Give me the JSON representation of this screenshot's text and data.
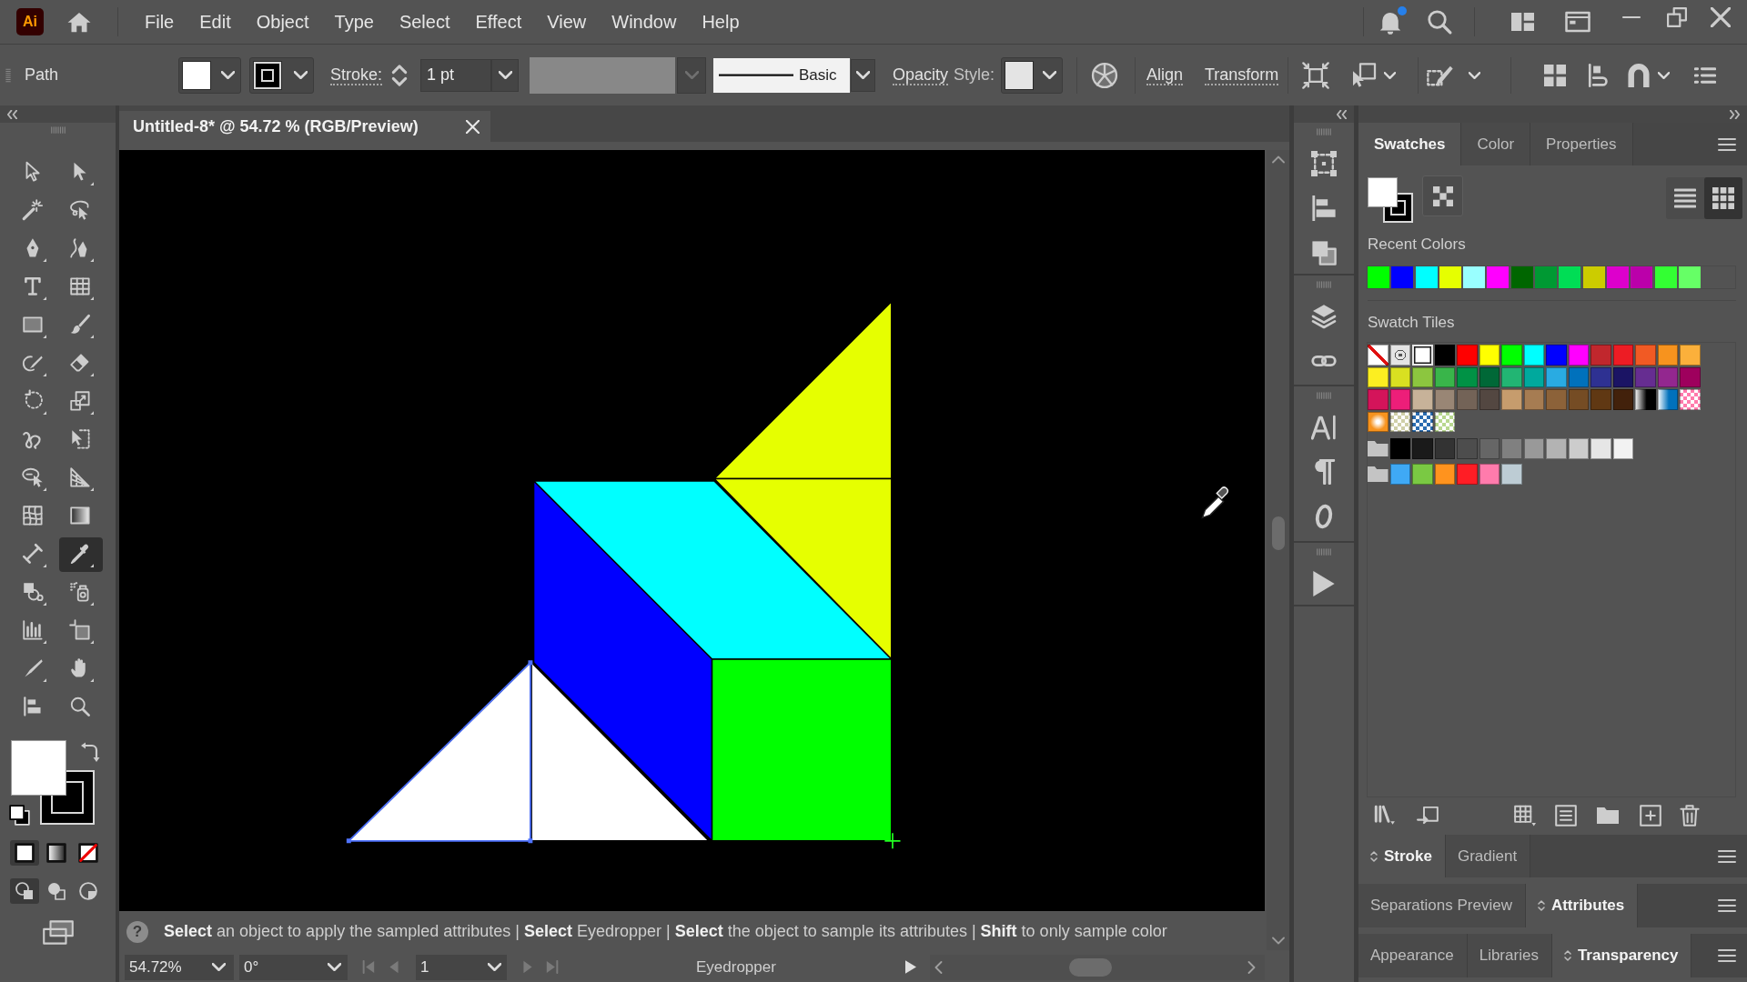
{
  "app": {
    "logo": "Ai"
  },
  "menu": [
    "File",
    "Edit",
    "Object",
    "Type",
    "Select",
    "Effect",
    "View",
    "Window",
    "Help"
  ],
  "notifications": {
    "unread": true
  },
  "control_bar": {
    "selection": "Path",
    "fill_stroke": [
      {
        "kind": "fill",
        "color": "#ffffff"
      },
      {
        "kind": "stroke",
        "color": "#000000"
      }
    ],
    "stroke_label": "Stroke:",
    "stroke_weight": "1 pt",
    "variable_width": {
      "disabled": true
    },
    "brush": "Basic",
    "opacity": "Opacity",
    "style_label": "Style:",
    "links": [
      "Align",
      "Transform"
    ]
  },
  "tools": [
    {
      "kind": "selection",
      "selected": false
    },
    {
      "kind": "direct",
      "selected": false
    },
    {
      "kind": "wand",
      "selected": false
    },
    {
      "kind": "lasso",
      "selected": false
    },
    {
      "kind": "pen",
      "selected": false
    },
    {
      "kind": "curvature",
      "selected": false
    },
    {
      "kind": "type",
      "selected": false
    },
    {
      "kind": "grid",
      "selected": false
    },
    {
      "kind": "rectangle",
      "selected": false
    },
    {
      "kind": "brush",
      "selected": false
    },
    {
      "kind": "shaper",
      "selected": false
    },
    {
      "kind": "eraser",
      "selected": false
    },
    {
      "kind": "rotate",
      "selected": false
    },
    {
      "kind": "scale",
      "selected": false
    },
    {
      "kind": "warp",
      "selected": false
    },
    {
      "kind": "transform",
      "selected": false
    },
    {
      "kind": "builder",
      "selected": false
    },
    {
      "kind": "perspective",
      "selected": false
    },
    {
      "kind": "mesh",
      "selected": false
    },
    {
      "kind": "gradient",
      "selected": false
    },
    {
      "kind": "measure",
      "selected": false
    },
    {
      "kind": "eyedropper",
      "selected": true
    },
    {
      "kind": "shapes",
      "selected": false
    },
    {
      "kind": "sprayer",
      "selected": false
    },
    {
      "kind": "graph",
      "selected": false
    },
    {
      "kind": "artboard",
      "selected": false
    },
    {
      "kind": "knife",
      "selected": false
    },
    {
      "kind": "hand",
      "selected": false
    },
    {
      "kind": "align",
      "selected": false
    },
    {
      "kind": "zoom",
      "selected": false
    }
  ],
  "toolbar": {
    "fill_stroke": [
      {
        "kind": "fill",
        "color": "#ffffff"
      },
      {
        "kind": "stroke",
        "color": "#000000"
      }
    ],
    "color_modes": [
      {
        "kind": "color",
        "selected": true
      },
      {
        "kind": "gradient",
        "selected": false
      },
      {
        "kind": "none",
        "selected": false
      }
    ],
    "draw_modes": [
      {
        "kind": "normal",
        "selected": true
      },
      {
        "kind": "behind",
        "selected": false
      },
      {
        "kind": "inside",
        "selected": false
      }
    ]
  },
  "document_tabs": [
    {
      "title": "Untitled-8* @ 54.72 % (RGB/Preview)",
      "selected": true
    }
  ],
  "hint": {
    "icon": "?",
    "text": "**Select** an object to apply the sampled attributes | **Select** Eyedropper | **Select** the object to sample its attributes | **Shift** to only sample color"
  },
  "status_bar": {
    "zoom": "54.72%",
    "rotation": "0°",
    "artboard": "1",
    "tool": "Eyedropper"
  },
  "swatches_panel": {
    "tabs": [
      {
        "label": "Swatches",
        "selected": true
      },
      {
        "label": "Color",
        "selected": false
      },
      {
        "label": "Properties",
        "selected": false
      }
    ],
    "fill_stroke": [
      {
        "kind": "fill",
        "color": "#ffffff"
      },
      {
        "kind": "stroke",
        "color": "#000000"
      }
    ],
    "views": [
      {
        "kind": "list",
        "selected": false
      },
      {
        "kind": "grid",
        "selected": true
      }
    ],
    "recent_label": "Recent Colors",
    "recent": [
      {
        "color": "#00ff00"
      },
      {
        "color": "#0000ff"
      },
      {
        "color": "#00ffff"
      },
      {
        "color": "#e6ff00"
      },
      {
        "color": "#99ffff"
      },
      {
        "color": "#ff00ff"
      },
      {
        "color": "#006600"
      },
      {
        "color": "#009933"
      },
      {
        "color": "#00dd55"
      },
      {
        "color": "#cccc00"
      },
      {
        "color": "#dd00cc"
      },
      {
        "color": "#bb00aa"
      },
      {
        "color": "#33ff33"
      },
      {
        "color": "#66ff66"
      }
    ],
    "tiles_label": "Swatch Tiles",
    "tiles": [
      {
        "kind": "none",
        "selected": false
      },
      {
        "kind": "registration",
        "selected": false
      },
      {
        "kind": "color",
        "color": "#ffffff",
        "selected": true
      },
      {
        "kind": "color",
        "color": "#000000",
        "selected": false
      },
      {
        "kind": "color",
        "color": "#ff0000",
        "selected": false
      },
      {
        "kind": "color",
        "color": "#ffff00",
        "selected": false
      },
      {
        "kind": "color",
        "color": "#00ff00",
        "selected": false
      },
      {
        "kind": "color",
        "color": "#00ffff",
        "selected": false
      },
      {
        "kind": "color",
        "color": "#0000ff",
        "selected": false
      },
      {
        "kind": "color",
        "color": "#ff00ff",
        "selected": false
      },
      {
        "kind": "color",
        "color": "#c1272d",
        "selected": false
      },
      {
        "kind": "color",
        "color": "#ed1c24",
        "selected": false
      },
      {
        "kind": "color",
        "color": "#f15a24",
        "selected": false
      },
      {
        "kind": "color",
        "color": "#f7931e",
        "selected": false
      },
      {
        "kind": "color",
        "color": "#fbb03b",
        "selected": false
      },
      {
        "kind": "color",
        "color": "#fcee21",
        "selected": false
      },
      {
        "kind": "color",
        "color": "#d9e021",
        "selected": false
      },
      {
        "kind": "color",
        "color": "#8cc63f",
        "selected": false
      },
      {
        "kind": "color",
        "color": "#39b54a",
        "selected": false
      },
      {
        "kind": "color",
        "color": "#009245",
        "selected": false
      },
      {
        "kind": "color",
        "color": "#006837",
        "selected": false
      },
      {
        "kind": "color",
        "color": "#22b573",
        "selected": false
      },
      {
        "kind": "color",
        "color": "#00a99d",
        "selected": false
      },
      {
        "kind": "color",
        "color": "#29abe2",
        "selected": false
      },
      {
        "kind": "color",
        "color": "#0071bc",
        "selected": false
      },
      {
        "kind": "color",
        "color": "#2e3192",
        "selected": false
      },
      {
        "kind": "color",
        "color": "#1b1464",
        "selected": false
      },
      {
        "kind": "color",
        "color": "#662d91",
        "selected": false
      },
      {
        "kind": "color",
        "color": "#93278f",
        "selected": false
      },
      {
        "kind": "color",
        "color": "#9e005d",
        "selected": false
      },
      {
        "kind": "color",
        "color": "#d4145a",
        "selected": false
      },
      {
        "kind": "color",
        "color": "#ed1e79",
        "selected": false
      },
      {
        "kind": "color",
        "color": "#c7b299",
        "selected": false
      },
      {
        "kind": "color",
        "color": "#998675",
        "selected": false
      },
      {
        "kind": "color",
        "color": "#736357",
        "selected": false
      },
      {
        "kind": "color",
        "color": "#534741",
        "selected": false
      },
      {
        "kind": "color",
        "color": "#c69c6d",
        "selected": false
      },
      {
        "kind": "color",
        "color": "#a67c52",
        "selected": false
      },
      {
        "kind": "color",
        "color": "#8c6239",
        "selected": false
      },
      {
        "kind": "color",
        "color": "#754c24",
        "selected": false
      },
      {
        "kind": "color",
        "color": "#603813",
        "selected": false
      },
      {
        "kind": "color",
        "color": "#42210b",
        "selected": false
      },
      {
        "kind": "gradient",
        "color": "#000000",
        "selected": false
      },
      {
        "kind": "gradient",
        "color": "#0071bc",
        "selected": false
      },
      {
        "kind": "pattern",
        "color": "#ff7bac",
        "selected": false
      },
      {
        "kind": "radial",
        "color": "#f7931e",
        "selected": false
      },
      {
        "kind": "pattern",
        "color": "#cfcfa8",
        "selected": false
      },
      {
        "kind": "pattern",
        "color": "#2b6cb0",
        "selected": false
      },
      {
        "kind": "pattern",
        "color": "#b8d890",
        "selected": false
      }
    ],
    "groups": [
      {
        "swatches": [
          {
            "color": "#000000"
          },
          {
            "color": "#1a1a1a"
          },
          {
            "color": "#333333"
          },
          {
            "color": "#4d4d4d"
          },
          {
            "color": "#666666"
          },
          {
            "color": "#808080"
          },
          {
            "color": "#999999"
          },
          {
            "color": "#b3b3b3"
          },
          {
            "color": "#cccccc"
          },
          {
            "color": "#e6e6e6"
          },
          {
            "color": "#f2f2f2"
          }
        ]
      },
      {
        "swatches": [
          {
            "color": "#3fa9f5"
          },
          {
            "color": "#7ac943"
          },
          {
            "color": "#ff931e"
          },
          {
            "color": "#ff1d25"
          },
          {
            "color": "#ff7bac"
          },
          {
            "color": "#bdccd4"
          }
        ]
      }
    ]
  },
  "panel_groups": [
    {
      "tabs": [
        {
          "label": "Stroke",
          "selected": true
        },
        {
          "label": "Gradient",
          "selected": false
        }
      ]
    },
    {
      "tabs": [
        {
          "label": "Separations Preview",
          "selected": false
        },
        {
          "label": "Attributes",
          "selected": true
        }
      ]
    },
    {
      "tabs": [
        {
          "label": "Appearance",
          "selected": false
        },
        {
          "label": "Libraries",
          "selected": false
        },
        {
          "label": "Transparency",
          "selected": true
        }
      ]
    }
  ]
}
